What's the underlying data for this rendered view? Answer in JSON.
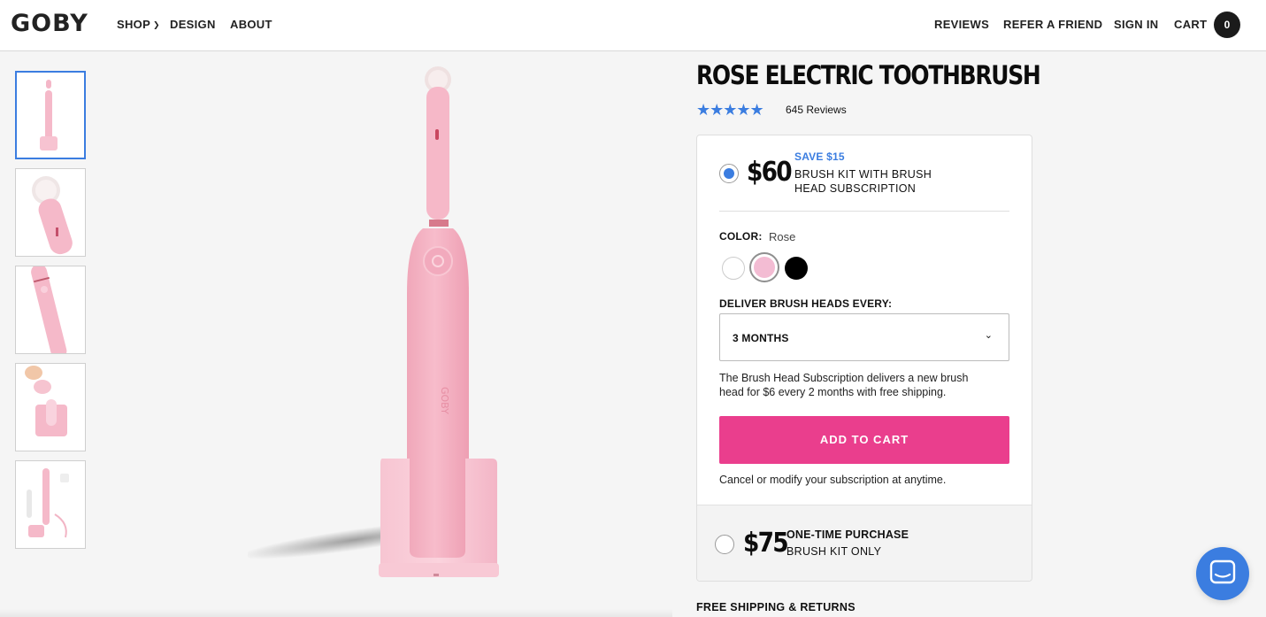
{
  "brand": {
    "logo": "GOBY"
  },
  "nav": {
    "left": [
      {
        "label": "SHOP",
        "has_dropdown": true
      },
      {
        "label": "DESIGN"
      },
      {
        "label": "ABOUT"
      }
    ],
    "right": [
      {
        "label": "REVIEWS"
      },
      {
        "label": "REFER A FRIEND"
      },
      {
        "label": "SIGN IN"
      },
      {
        "label": "CART"
      }
    ],
    "cart_count": "0"
  },
  "gallery": {
    "thumbnails": [
      "brush-on-stand",
      "brush-head-closeup",
      "brush-handle-angle",
      "hand-placing-stand",
      "kit-contents-flatlay"
    ],
    "active_index": 0,
    "hero_brand_text": "GOBY"
  },
  "product": {
    "title": "ROSE ELECTRIC TOOTHBRUSH",
    "stars": "★★★★★",
    "rating": 5,
    "reviews_label": "645 Reviews"
  },
  "subscription_option": {
    "selected": true,
    "price": "$60",
    "save_label": "SAVE $15",
    "description": "BRUSH KIT WITH BRUSH HEAD SUBSCRIPTION",
    "color_label": "COLOR:",
    "color_value": "Rose",
    "swatches": [
      {
        "name": "White",
        "hex": "#ffffff"
      },
      {
        "name": "Rose",
        "hex": "#f3bcd3",
        "selected": true
      },
      {
        "name": "Black",
        "hex": "#000000"
      }
    ],
    "deliver_label": "DELIVER BRUSH HEADS EVERY:",
    "deliver_value": "3 MONTHS",
    "note": "The Brush Head Subscription delivers a new brush head for $6 every 2 months with free shipping.",
    "add_to_cart_label": "ADD TO CART",
    "cancel_note": "Cancel or modify your subscription at anytime."
  },
  "onetime_option": {
    "selected": false,
    "price": "$75",
    "title": "ONE-TIME PURCHASE",
    "subtitle": "BRUSH KIT ONLY"
  },
  "shipping_heading": "FREE SHIPPING & RETURNS",
  "colors": {
    "accent_blue": "#3b7de0",
    "cta_pink": "#ea3e8d",
    "product_pink": "#f5b9c9"
  }
}
